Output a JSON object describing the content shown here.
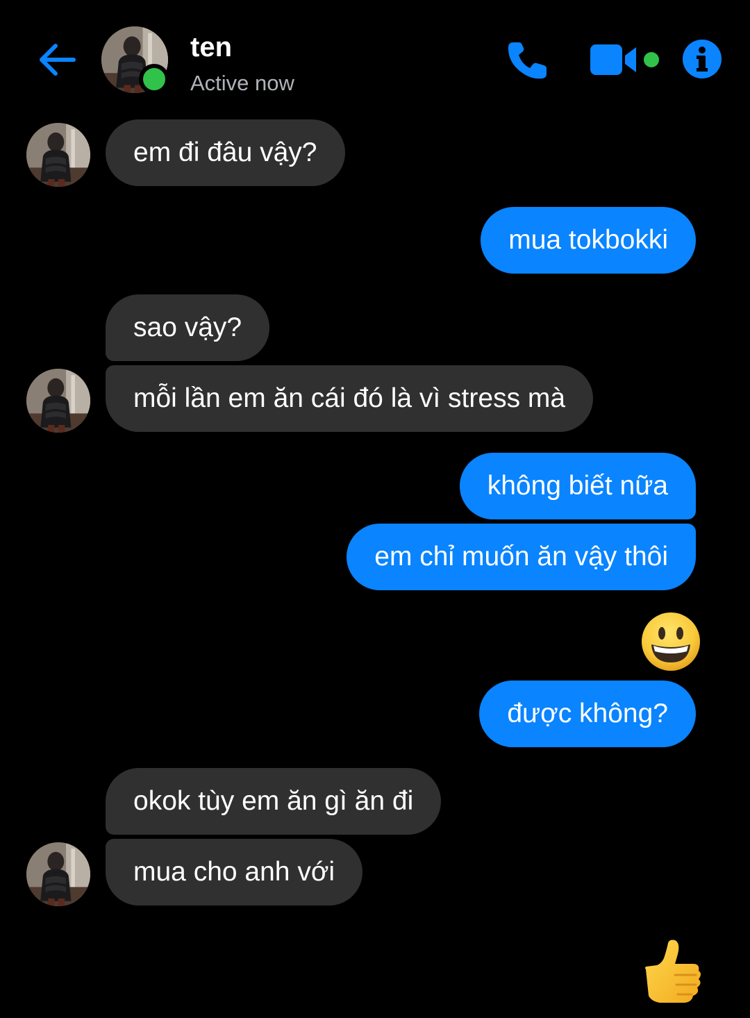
{
  "header": {
    "contact_name": "ten",
    "status": "Active now",
    "icons": {
      "back": "back-arrow-icon",
      "call": "phone-icon",
      "video": "video-camera-icon",
      "info": "info-icon"
    },
    "accent_color": "#0a84ff",
    "online_color": "#31c24a"
  },
  "colors": {
    "background": "#000000",
    "incoming_bubble": "#303030",
    "outgoing_bubble": "#0a84ff"
  },
  "messages": [
    {
      "from": "them",
      "text": "em đi đâu vậy?"
    },
    {
      "from": "me",
      "text": "mua tokbokki"
    },
    {
      "from": "them",
      "text": "sao vậy?"
    },
    {
      "from": "them",
      "text": "mỗi lần em ăn cái đó là vì stress mà"
    },
    {
      "from": "me",
      "text": "không biết nữa"
    },
    {
      "from": "me",
      "text": "em chỉ muốn ăn vậy thôi"
    },
    {
      "from": "me",
      "emoji": "grinning-face"
    },
    {
      "from": "me",
      "text": "được không?"
    },
    {
      "from": "them",
      "text": "okok tùy em ăn gì ăn đi"
    },
    {
      "from": "them",
      "text": "mua cho anh với"
    },
    {
      "from": "me",
      "emoji": "thumbs-up"
    }
  ]
}
